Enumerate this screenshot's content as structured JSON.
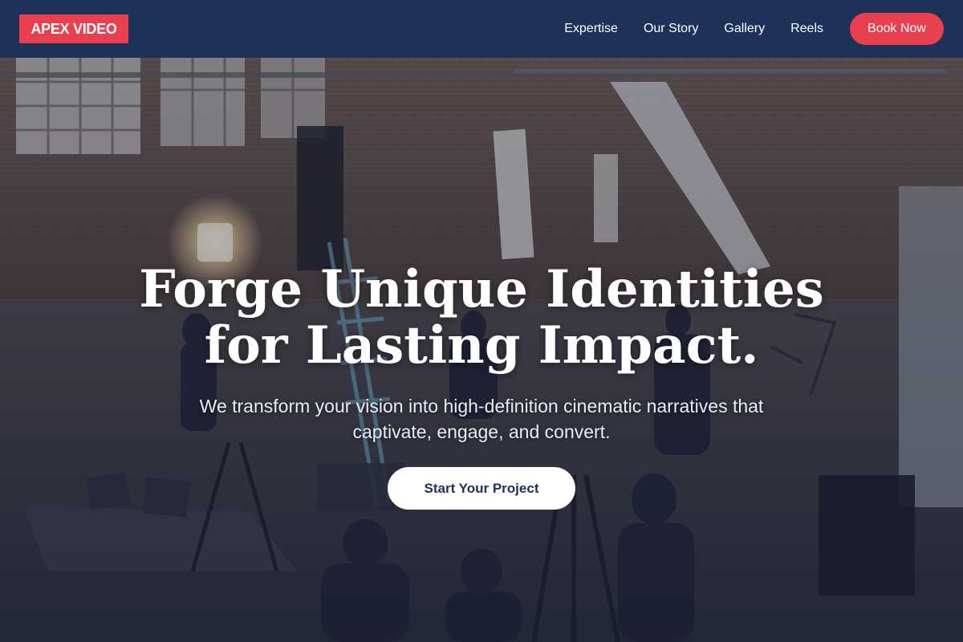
{
  "brand": {
    "logo_text": "APEX VIDEO",
    "accent": "#e8404f",
    "navy": "#1d3159"
  },
  "nav": {
    "items": [
      {
        "label": "Expertise"
      },
      {
        "label": "Our Story"
      },
      {
        "label": "Gallery"
      },
      {
        "label": "Reels"
      }
    ],
    "cta_label": "Book Now"
  },
  "hero": {
    "headline_line1": "Forge Unique Identities",
    "headline_line2": "for Lasting Impact.",
    "subtitle_line1": "We transform your vision into high-definition cinematic narratives that",
    "subtitle_line2": "captivate, engage, and convert.",
    "cta_label": "Start Your Project",
    "background_image": "film-production-warehouse-photo"
  }
}
